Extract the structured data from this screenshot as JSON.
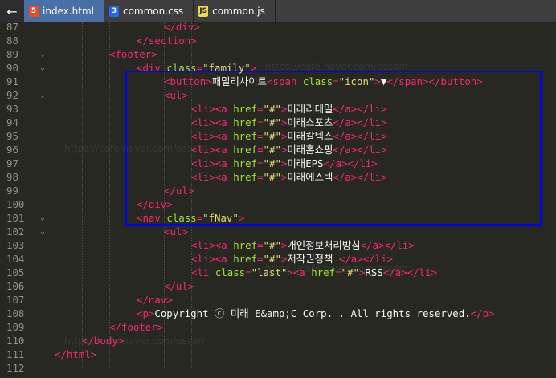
{
  "nav": {
    "back_icon": "←"
  },
  "tabs": [
    {
      "icon_text": "5",
      "icon_type": "html-file-icon",
      "label": "index.html",
      "active": true
    },
    {
      "icon_text": "3",
      "icon_type": "css-file-icon",
      "label": "common.css",
      "active": false
    },
    {
      "icon_text": "JS",
      "icon_type": "js-file-icon",
      "label": "common.js",
      "active": false
    }
  ],
  "watermark": "https://cafe.naver.com/ossam",
  "colors": {
    "tag": "#f92672",
    "attr": "#a6e22e",
    "string": "#e6db74",
    "text": "#f8f8f2",
    "highlight_border": "#0000ff"
  },
  "lines": [
    {
      "n": "87",
      "segs": [
        [
          "tag",
          "</div>"
        ]
      ]
    },
    {
      "n": "88",
      "segs": [
        [
          "tag",
          "</section>"
        ]
      ]
    },
    {
      "n": "89",
      "segs": [
        [
          "tag",
          "<footer>"
        ]
      ]
    },
    {
      "n": "90",
      "segs": [
        [
          "tag",
          "<div "
        ],
        [
          "attr",
          "class"
        ],
        [
          "tag",
          "="
        ],
        [
          "str",
          "\"family\""
        ],
        [
          "tag",
          ">"
        ]
      ]
    },
    {
      "n": "91",
      "segs": [
        [
          "tag",
          "<button>"
        ],
        [
          "txt",
          "패밀리사이트"
        ],
        [
          "tag",
          "<span "
        ],
        [
          "attr",
          "class"
        ],
        [
          "tag",
          "="
        ],
        [
          "str",
          "\"icon\""
        ],
        [
          "tag",
          ">"
        ],
        [
          "txt",
          "▼"
        ],
        [
          "tag",
          "</span></button>"
        ]
      ]
    },
    {
      "n": "92",
      "segs": [
        [
          "tag",
          "<ul>"
        ]
      ]
    },
    {
      "n": "93",
      "segs": [
        [
          "tag",
          "<li><a "
        ],
        [
          "attr",
          "href"
        ],
        [
          "tag",
          "="
        ],
        [
          "str",
          "\"#\""
        ],
        [
          "tag",
          ">"
        ],
        [
          "txt",
          "미래리테일"
        ],
        [
          "tag",
          "</a></li>"
        ]
      ]
    },
    {
      "n": "94",
      "segs": [
        [
          "tag",
          "<li><a "
        ],
        [
          "attr",
          "href"
        ],
        [
          "tag",
          "="
        ],
        [
          "str",
          "\"#\""
        ],
        [
          "tag",
          ">"
        ],
        [
          "txt",
          "미래스포츠"
        ],
        [
          "tag",
          "</a></li>"
        ]
      ]
    },
    {
      "n": "95",
      "segs": [
        [
          "tag",
          "<li><a "
        ],
        [
          "attr",
          "href"
        ],
        [
          "tag",
          "="
        ],
        [
          "str",
          "\"#\""
        ],
        [
          "tag",
          ">"
        ],
        [
          "txt",
          "미래칼텍스"
        ],
        [
          "tag",
          "</a></li>"
        ]
      ]
    },
    {
      "n": "96",
      "segs": [
        [
          "tag",
          "<li><a "
        ],
        [
          "attr",
          "href"
        ],
        [
          "tag",
          "="
        ],
        [
          "str",
          "\"#\""
        ],
        [
          "tag",
          ">"
        ],
        [
          "txt",
          "미래홈쇼핑"
        ],
        [
          "tag",
          "</a></li>"
        ]
      ]
    },
    {
      "n": "97",
      "segs": [
        [
          "tag",
          "<li><a "
        ],
        [
          "attr",
          "href"
        ],
        [
          "tag",
          "="
        ],
        [
          "str",
          "\"#\""
        ],
        [
          "tag",
          ">"
        ],
        [
          "txt",
          "미래EPS"
        ],
        [
          "tag",
          "</a></li>"
        ]
      ]
    },
    {
      "n": "98",
      "segs": [
        [
          "tag",
          "<li><a "
        ],
        [
          "attr",
          "href"
        ],
        [
          "tag",
          "="
        ],
        [
          "str",
          "\"#\""
        ],
        [
          "tag",
          ">"
        ],
        [
          "txt",
          "미래에스텍"
        ],
        [
          "tag",
          "</a></li>"
        ]
      ]
    },
    {
      "n": "99",
      "segs": [
        [
          "tag",
          "</ul>"
        ]
      ]
    },
    {
      "n": "100",
      "segs": [
        [
          "tag",
          "</div>"
        ]
      ]
    },
    {
      "n": "101",
      "segs": [
        [
          "tag",
          "<nav "
        ],
        [
          "attr",
          "class"
        ],
        [
          "tag",
          "="
        ],
        [
          "str",
          "\"fNav\""
        ],
        [
          "tag",
          ">"
        ]
      ]
    },
    {
      "n": "102",
      "segs": [
        [
          "tag",
          "<ul>"
        ]
      ]
    },
    {
      "n": "103",
      "segs": [
        [
          "tag",
          "<li><a "
        ],
        [
          "attr",
          "href"
        ],
        [
          "tag",
          "="
        ],
        [
          "str",
          "\"#\""
        ],
        [
          "tag",
          ">"
        ],
        [
          "txt",
          "개인정보처리방침"
        ],
        [
          "tag",
          "</a></li>"
        ]
      ]
    },
    {
      "n": "104",
      "segs": [
        [
          "tag",
          "<li><a "
        ],
        [
          "attr",
          "href"
        ],
        [
          "tag",
          "="
        ],
        [
          "str",
          "\"#\""
        ],
        [
          "tag",
          ">"
        ],
        [
          "txt",
          "저작권정책 "
        ],
        [
          "tag",
          "</a></li>"
        ]
      ]
    },
    {
      "n": "105",
      "segs": [
        [
          "tag",
          "<li "
        ],
        [
          "attr",
          "class"
        ],
        [
          "tag",
          "="
        ],
        [
          "str",
          "\"last\""
        ],
        [
          "tag",
          "><a "
        ],
        [
          "attr",
          "href"
        ],
        [
          "tag",
          "="
        ],
        [
          "str",
          "\"#\""
        ],
        [
          "tag",
          ">"
        ],
        [
          "txt",
          "RSS"
        ],
        [
          "tag",
          "</a></li>"
        ]
      ]
    },
    {
      "n": "106",
      "segs": [
        [
          "tag",
          "</ul>"
        ]
      ]
    },
    {
      "n": "107",
      "segs": [
        [
          "tag",
          "</nav>"
        ]
      ]
    },
    {
      "n": "108",
      "segs": [
        [
          "tag",
          "<p>"
        ],
        [
          "txt",
          "Copyright ⓒ 미래 E&amp;C Corp. . All rights reserved."
        ],
        [
          "tag",
          "</p>"
        ]
      ]
    },
    {
      "n": "109",
      "segs": [
        [
          "tag",
          "</footer>"
        ]
      ]
    },
    {
      "n": "110",
      "segs": [
        [
          "tag",
          "</body>"
        ]
      ]
    },
    {
      "n": "111",
      "segs": [
        [
          "tag",
          "</html>"
        ]
      ]
    },
    {
      "n": "112",
      "segs": []
    }
  ]
}
